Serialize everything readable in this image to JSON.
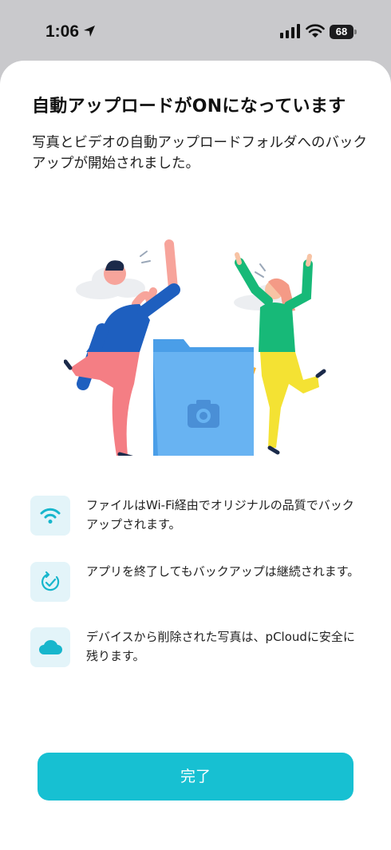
{
  "status": {
    "time": "1:06",
    "battery": "68"
  },
  "title": "自動アップロードがONになっています",
  "subtitle": "写真とビデオの自動アップロードフォルダへのバックアップが開始されました。",
  "features": [
    {
      "icon": "wifi-icon",
      "text": "ファイルはWi-Fi経由でオリジナルの品質でバックアップされます。"
    },
    {
      "icon": "check-refresh-icon",
      "text": "アプリを終了してもバックアップは継続されます。"
    },
    {
      "icon": "cloud-icon",
      "text": "デバイスから削除された写真は、pCloudに安全に残ります。"
    }
  ],
  "done_label": "完了",
  "colors": {
    "accent": "#17c0d2",
    "icon_bg": "#e3f4f9",
    "icon_fg": "#17b6cc"
  }
}
